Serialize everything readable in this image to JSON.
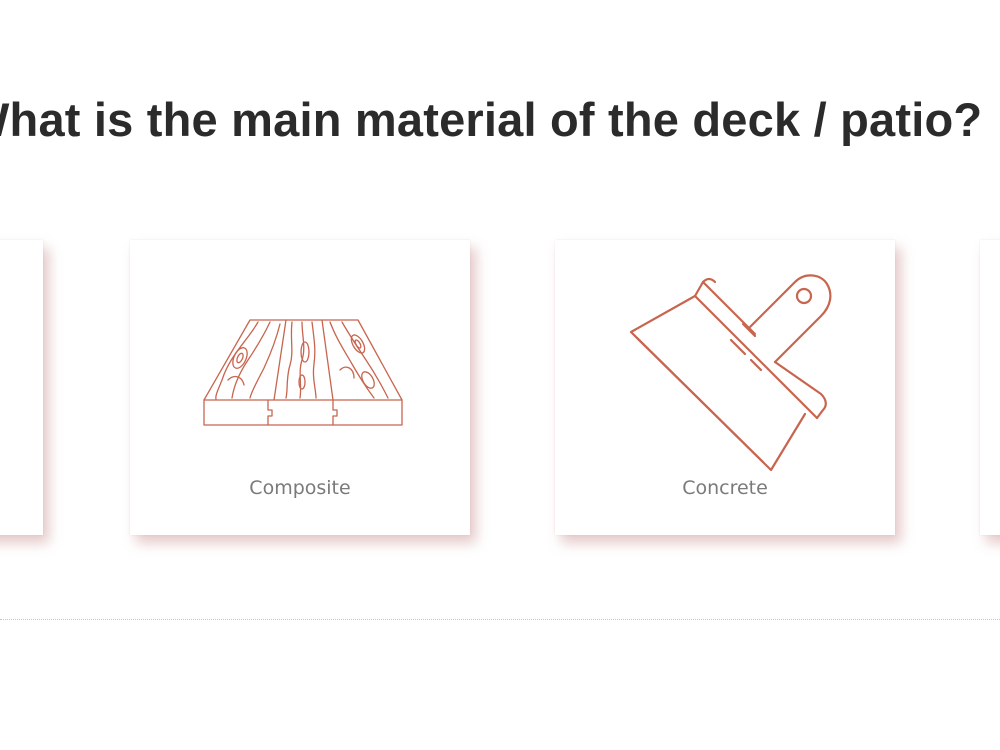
{
  "question": {
    "title": "What is the main material of the deck / patio?"
  },
  "options": [
    {
      "label": "",
      "icon": "hidden-option-icon"
    },
    {
      "label": "Composite",
      "icon": "wood-planks-icon"
    },
    {
      "label": "Concrete",
      "icon": "putty-knife-icon"
    },
    {
      "label": "",
      "icon": "hidden-option-icon"
    }
  ],
  "colors": {
    "icon_stroke": "#c8654f",
    "title_text": "#2b2b2b",
    "label_text": "#7a7a7a",
    "card_shadow": "#be7878"
  }
}
